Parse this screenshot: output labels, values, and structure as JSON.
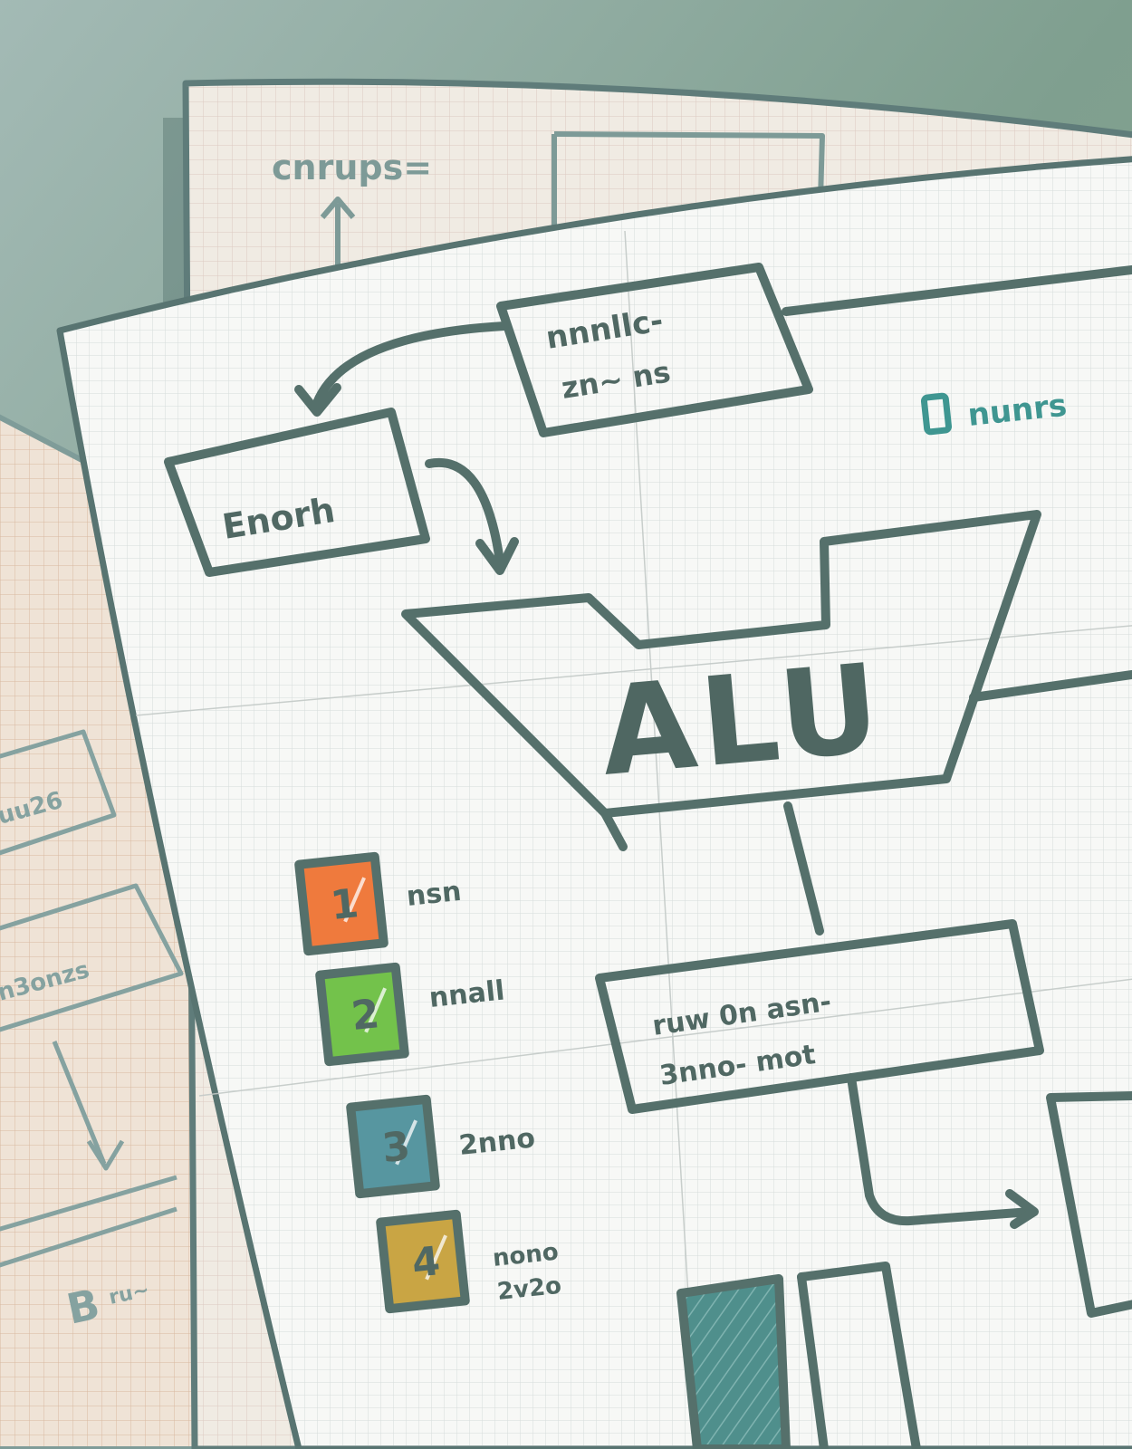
{
  "scene": {
    "background_color": "#8da996",
    "ink_color": "#55706b",
    "ink_light_color": "#7d9a97",
    "paper_white": "#f6f7f4",
    "paper_tan": "#efe6dc"
  },
  "main_sheet": {
    "alu_label": "ALU",
    "legend": [
      {
        "number": "1",
        "color": "#ef7a3d"
      },
      {
        "number": "2",
        "color": "#73c24b"
      },
      {
        "number": "3",
        "color": "#5796a0"
      },
      {
        "number": "4",
        "color": "#c9a544"
      }
    ]
  }
}
